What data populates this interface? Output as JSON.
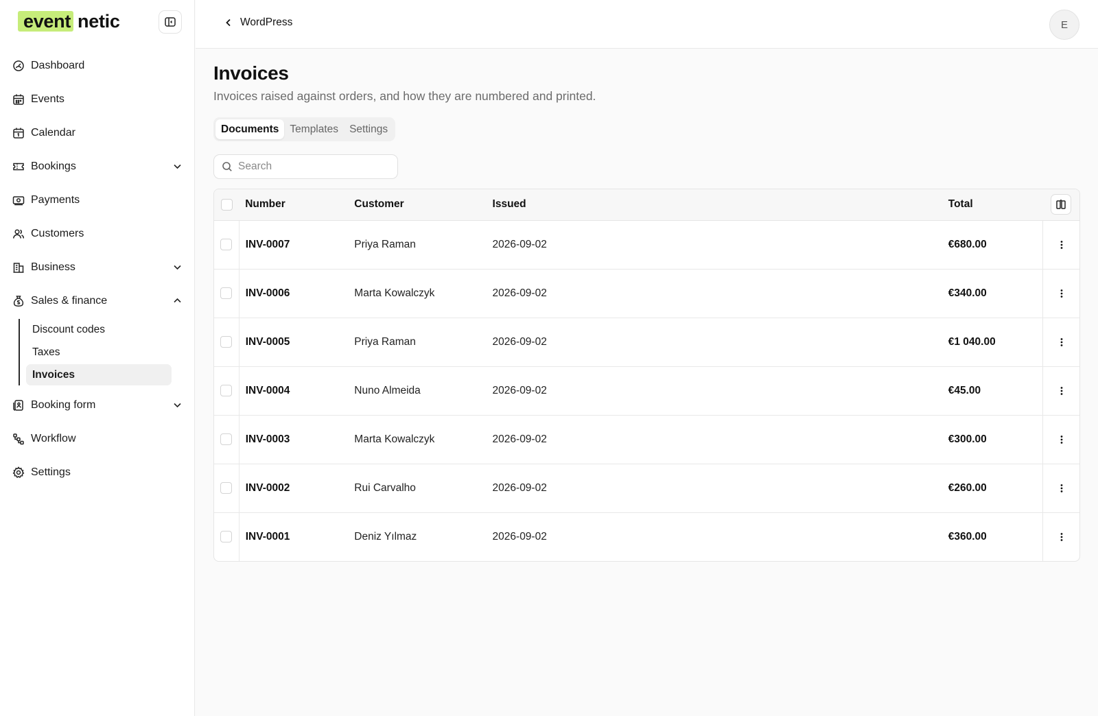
{
  "brand": {
    "logo_highlight": "event",
    "logo_rest": "netic",
    "accent": "#c6ec7a"
  },
  "sidebar": {
    "items": [
      {
        "label": "Dashboard",
        "icon": "dashboard-icon"
      },
      {
        "label": "Events",
        "icon": "calendar-grid-icon"
      },
      {
        "label": "Calendar",
        "icon": "calendar-icon"
      },
      {
        "label": "Bookings",
        "icon": "ticket-icon",
        "expandable": true
      },
      {
        "label": "Payments",
        "icon": "banknote-icon"
      },
      {
        "label": "Customers",
        "icon": "users-icon"
      },
      {
        "label": "Business",
        "icon": "building-icon",
        "expandable": true
      },
      {
        "label": "Sales & finance",
        "icon": "money-bag-icon",
        "expanded": true
      },
      {
        "label": "Booking form",
        "icon": "form-icon",
        "expandable": true
      },
      {
        "label": "Workflow",
        "icon": "workflow-icon"
      },
      {
        "label": "Settings",
        "icon": "gear-icon"
      }
    ],
    "sub_items": [
      {
        "label": "Discount codes"
      },
      {
        "label": "Taxes"
      },
      {
        "label": "Invoices",
        "active": true
      }
    ]
  },
  "topbar": {
    "back_label": "WordPress",
    "avatar_initial": "E"
  },
  "page": {
    "title": "Invoices",
    "description": "Invoices raised against orders, and how they are numbered and printed."
  },
  "tabs": [
    {
      "label": "Documents",
      "active": true
    },
    {
      "label": "Templates"
    },
    {
      "label": "Settings"
    }
  ],
  "search": {
    "placeholder": "Search",
    "value": ""
  },
  "table": {
    "headers": {
      "number": "Number",
      "customer": "Customer",
      "issued": "Issued",
      "total": "Total"
    },
    "rows": [
      {
        "number": "INV-0007",
        "customer": "Priya Raman",
        "issued": "2026-09-02",
        "total": "€680.00"
      },
      {
        "number": "INV-0006",
        "customer": "Marta Kowalczyk",
        "issued": "2026-09-02",
        "total": "€340.00"
      },
      {
        "number": "INV-0005",
        "customer": "Priya Raman",
        "issued": "2026-09-02",
        "total": "€1 040.00"
      },
      {
        "number": "INV-0004",
        "customer": "Nuno Almeida",
        "issued": "2026-09-02",
        "total": "€45.00"
      },
      {
        "number": "INV-0003",
        "customer": "Marta Kowalczyk",
        "issued": "2026-09-02",
        "total": "€300.00"
      },
      {
        "number": "INV-0002",
        "customer": "Rui Carvalho",
        "issued": "2026-09-02",
        "total": "€260.00"
      },
      {
        "number": "INV-0001",
        "customer": "Deniz Yılmaz",
        "issued": "2026-09-02",
        "total": "€360.00"
      }
    ]
  }
}
